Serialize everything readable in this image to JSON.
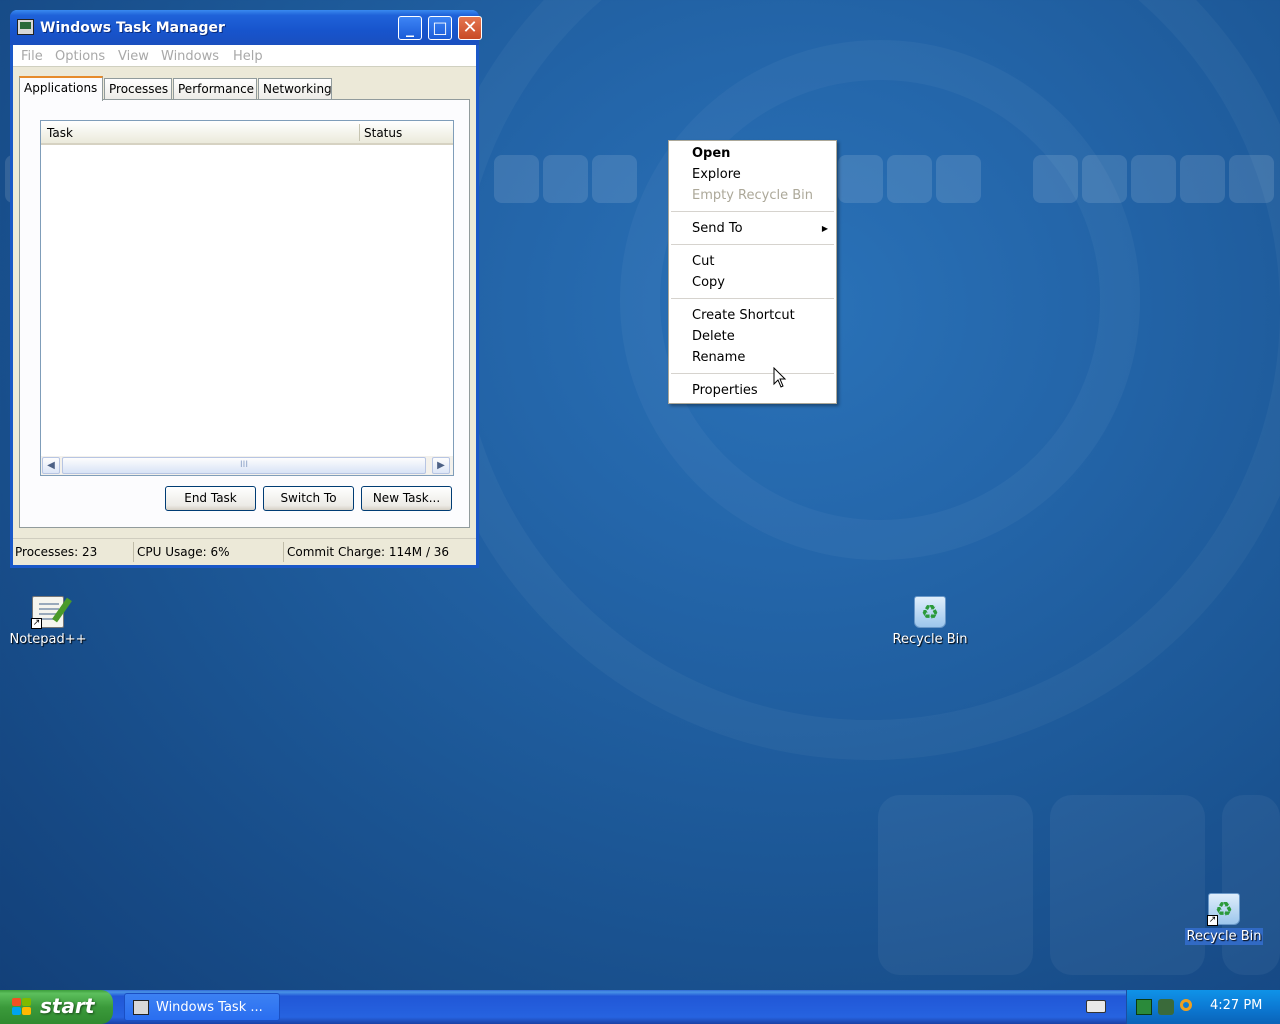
{
  "task_manager": {
    "title": "Windows Task Manager",
    "window_controls": {
      "minimize": "_",
      "maximize": "□",
      "close": "✕"
    },
    "menu": [
      "File",
      "Options",
      "View",
      "Windows",
      "Help"
    ],
    "tabs": [
      "Applications",
      "Processes",
      "Performance",
      "Networking"
    ],
    "active_tab": "Applications",
    "columns": {
      "task": "Task",
      "status": "Status"
    },
    "scroll_grip": "III",
    "buttons": {
      "end_task": "End Task",
      "switch_to": "Switch To",
      "new_task": "New Task..."
    },
    "status": {
      "processes": "Processes: 23",
      "cpu": "CPU Usage: 6%",
      "commit": "Commit Charge: 114M / 36"
    }
  },
  "context_menu": {
    "items": {
      "open": "Open",
      "explore": "Explore",
      "empty_recycle_bin": "Empty Recycle Bin",
      "send_to": "Send To",
      "cut": "Cut",
      "copy": "Copy",
      "create_shortcut": "Create Shortcut",
      "delete": "Delete",
      "rename": "Rename",
      "properties": "Properties"
    },
    "submenu_arrow": "▶"
  },
  "desktop": {
    "icons": {
      "notepad": "Notepad++",
      "recycle_bin": "Recycle Bin",
      "recycle_bin_shortcut": "Recycle Bin"
    },
    "shortcut_arrow": "↗"
  },
  "taskbar": {
    "start_label": "start",
    "task_button": "Windows Task ...",
    "clock": "4:27 PM"
  },
  "colors": {
    "desktop_blue": "#2466aa",
    "titlebar_blue": "#1754cc",
    "start_green": "#3b9a3b",
    "selection": "#316ac5"
  }
}
